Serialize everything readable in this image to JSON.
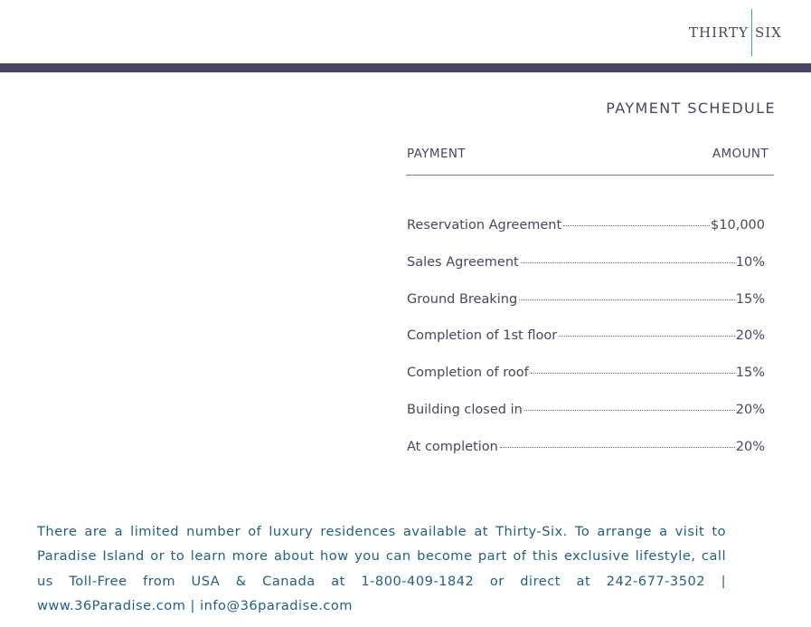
{
  "brand": {
    "left": "THIRTY",
    "right": "SIX",
    "accent_color": "#4b4463",
    "divider_color": "#3aa69c"
  },
  "title": "PAYMENT SCHEDULE",
  "table": {
    "col_payment": "PAYMENT",
    "col_amount": "AMOUNT",
    "rows": [
      {
        "label": "Reservation Agreement",
        "amount": "$10,000"
      },
      {
        "label": "Sales Agreement",
        "amount": "10%"
      },
      {
        "label": "Ground Breaking",
        "amount": "15%"
      },
      {
        "label": "Completion of 1st floor",
        "amount": "20%"
      },
      {
        "label": "Completion of roof",
        "amount": "15%"
      },
      {
        "label": "Building closed in",
        "amount": "20%"
      },
      {
        "label": "At completion",
        "amount": "20%"
      }
    ]
  },
  "footer": {
    "text": "There are a limited number of luxury residences available at Thirty-Six. To arrange a visit to Paradise Island or to learn more about how you can become part of this exclusive lifestyle, call us Toll-Free from USA & Canada at 1-800-409-1842 or direct at 242-677-3502 | www.36Paradise.com | info@36paradise.com",
    "text_color": "#1e5f84"
  }
}
